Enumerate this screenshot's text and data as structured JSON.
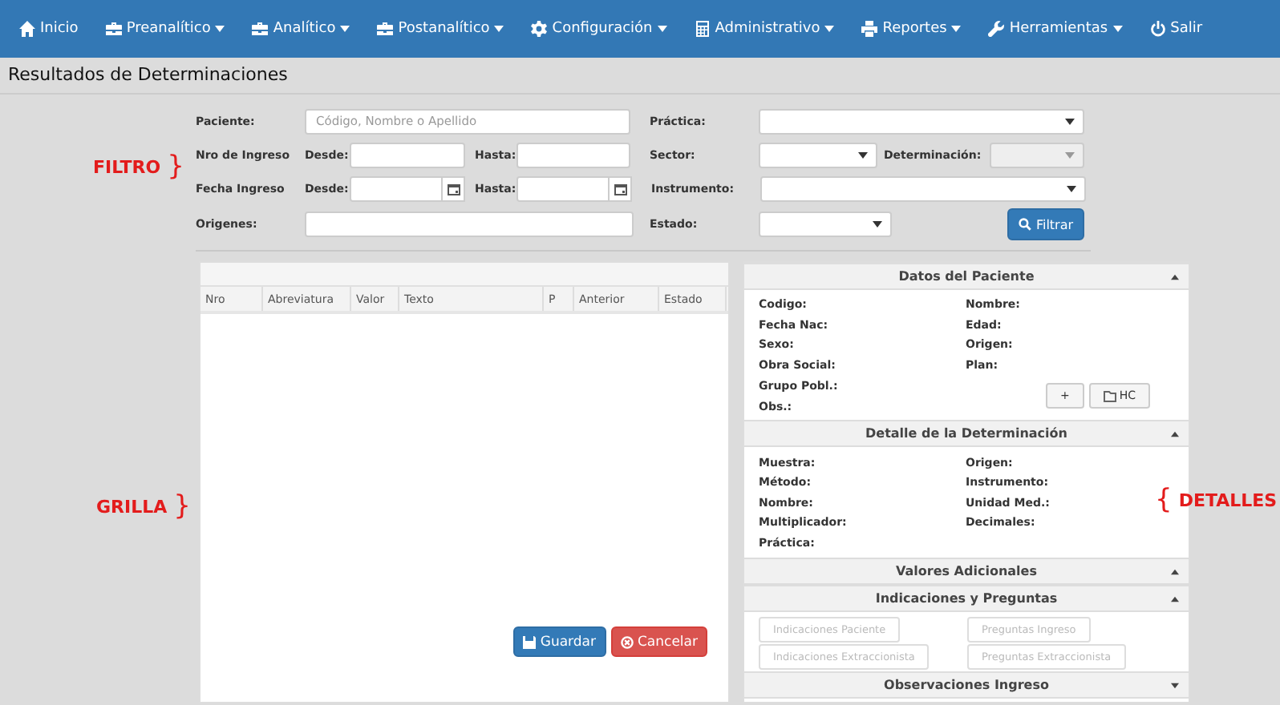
{
  "nav": {
    "items": [
      {
        "label": "Inicio",
        "dropdown": false
      },
      {
        "label": "Preanalítico",
        "dropdown": true
      },
      {
        "label": "Analítico",
        "dropdown": true
      },
      {
        "label": "Postanalítico",
        "dropdown": true
      },
      {
        "label": "Configuración",
        "dropdown": true
      },
      {
        "label": "Administrativo",
        "dropdown": true
      },
      {
        "label": "Reportes",
        "dropdown": true
      },
      {
        "label": "Herramientas",
        "dropdown": true
      },
      {
        "label": "Salir",
        "dropdown": false
      }
    ]
  },
  "page_title": "Resultados de Determinaciones",
  "filter": {
    "paciente": {
      "label": "Paciente:",
      "placeholder": "Código, Nombre o Apellido"
    },
    "nro_ingreso": {
      "label": "Nro de Ingreso",
      "desde": "Desde:",
      "hasta": "Hasta:"
    },
    "fecha_ingreso": {
      "label": "Fecha Ingreso",
      "desde": "Desde:",
      "hasta": "Hasta:"
    },
    "origenes": {
      "label": "Origenes:"
    },
    "practica": {
      "label": "Práctica:",
      "disabled": false
    },
    "sector": {
      "label": "Sector:",
      "disabled": false
    },
    "determinacion": {
      "label": "Determinación:",
      "disabled": true
    },
    "instrumento": {
      "label": "Instrumento:",
      "disabled": false
    },
    "estado": {
      "label": "Estado:",
      "disabled": false
    },
    "button": "Filtrar"
  },
  "grid": {
    "columns": [
      "Nro",
      "Abreviatura",
      "Valor",
      "Texto",
      "P",
      "Anterior",
      "Estado"
    ],
    "buttons": [
      {
        "label": "Guardar",
        "kind": "primary"
      },
      {
        "label": "Cancelar",
        "kind": "danger"
      }
    ]
  },
  "details": {
    "sections": [
      {
        "title": "Datos del Paciente",
        "expanded": true,
        "kind": "fields",
        "rows": [
          [
            "Codigo:",
            "Nombre:"
          ],
          [
            "Fecha Nac:",
            "Edad:"
          ],
          [
            "Sexo:",
            "Origen:"
          ],
          [
            "Obra Social:",
            "Plan:"
          ],
          [
            "Grupo Pobl.:"
          ],
          [
            "Obs.:"
          ]
        ],
        "actions": [
          "+",
          "HC"
        ]
      },
      {
        "title": "Detalle de la Determinación",
        "expanded": true,
        "kind": "fields",
        "rows": [
          [
            "Muestra:",
            "Origen:"
          ],
          [
            "Método:",
            "Instrumento:"
          ],
          [
            "Nombre:",
            "Unidad Med.:"
          ],
          [
            "Multiplicador:",
            "Decimales:"
          ],
          [
            "Práctica:"
          ]
        ]
      },
      {
        "title": "Valores Adicionales",
        "expanded": true
      },
      {
        "title": "Indicaciones y Preguntas",
        "expanded": true,
        "kind": "buttons",
        "buttons": [
          {
            "label": "Indicaciones Paciente",
            "disabled": true
          },
          {
            "label": "Preguntas Ingreso",
            "disabled": true
          },
          {
            "label": "Indicaciones Extraccionista",
            "disabled": true
          },
          {
            "label": "Preguntas Extraccionista",
            "disabled": true
          }
        ]
      },
      {
        "title": "Observaciones Ingreso",
        "expanded": false
      }
    ]
  },
  "annotations": [
    {
      "parts": [
        {
          "text": "FILTRO"
        },
        {
          "brace": "}"
        }
      ]
    },
    {
      "parts": [
        {
          "text": "GRILLA"
        },
        {
          "brace": "}"
        }
      ]
    },
    {
      "parts": [
        {
          "brace": "{"
        },
        {
          "text": "DETALLES"
        }
      ]
    }
  ]
}
